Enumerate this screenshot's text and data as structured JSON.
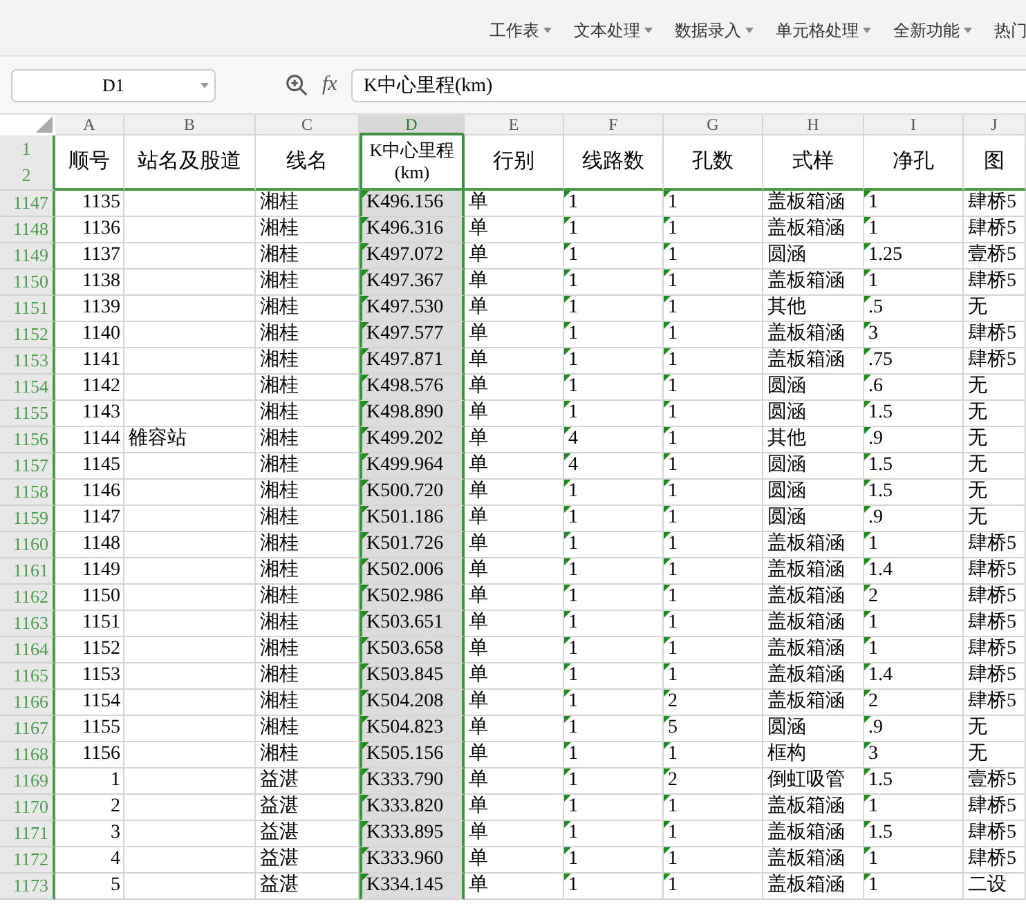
{
  "toolbar": {
    "menus": [
      {
        "label": "工作表"
      },
      {
        "label": "文本处理"
      },
      {
        "label": "数据录入"
      },
      {
        "label": "单元格处理"
      },
      {
        "label": "全新功能"
      },
      {
        "label": "热门"
      }
    ]
  },
  "formula_bar": {
    "name_box": "D1",
    "fx_label": "fx",
    "formula": "K中心里程(km)"
  },
  "columns": [
    {
      "letter": "A",
      "selected": false,
      "flagged": false
    },
    {
      "letter": "B",
      "selected": false,
      "flagged": false
    },
    {
      "letter": "C",
      "selected": false,
      "flagged": false
    },
    {
      "letter": "D",
      "selected": true,
      "flagged": true
    },
    {
      "letter": "E",
      "selected": false,
      "flagged": false
    },
    {
      "letter": "F",
      "selected": false,
      "flagged": true
    },
    {
      "letter": "G",
      "selected": false,
      "flagged": true
    },
    {
      "letter": "H",
      "selected": false,
      "flagged": false
    },
    {
      "letter": "I",
      "selected": false,
      "flagged": true
    },
    {
      "letter": "J",
      "selected": false,
      "flagged": false
    }
  ],
  "header": {
    "row_numbers": [
      "1",
      "2"
    ],
    "cells": [
      "顺号",
      "站名及股道",
      "线名",
      "K中心里程(km)",
      "行别",
      "线路数",
      "孔数",
      "式样",
      "净孔",
      "图"
    ]
  },
  "rows": [
    {
      "num": "1147",
      "cells": [
        "1135",
        "",
        "湘桂",
        "K496.156",
        "单",
        "1",
        "1",
        "盖板箱涵",
        "1",
        "肆桥5"
      ]
    },
    {
      "num": "1148",
      "cells": [
        "1136",
        "",
        "湘桂",
        "K496.316",
        "单",
        "1",
        "1",
        "盖板箱涵",
        "1",
        "肆桥5"
      ]
    },
    {
      "num": "1149",
      "cells": [
        "1137",
        "",
        "湘桂",
        "K497.072",
        "单",
        "1",
        "1",
        "圆涵",
        "1.25",
        "壹桥5"
      ]
    },
    {
      "num": "1150",
      "cells": [
        "1138",
        "",
        "湘桂",
        "K497.367",
        "单",
        "1",
        "1",
        "盖板箱涵",
        "1",
        "肆桥5"
      ]
    },
    {
      "num": "1151",
      "cells": [
        "1139",
        "",
        "湘桂",
        "K497.530",
        "单",
        "1",
        "1",
        "其他",
        ".5",
        "无"
      ]
    },
    {
      "num": "1152",
      "cells": [
        "1140",
        "",
        "湘桂",
        "K497.577",
        "单",
        "1",
        "1",
        "盖板箱涵",
        "3",
        "肆桥5"
      ]
    },
    {
      "num": "1153",
      "cells": [
        "1141",
        "",
        "湘桂",
        "K497.871",
        "单",
        "1",
        "1",
        "盖板箱涵",
        ".75",
        "肆桥5"
      ]
    },
    {
      "num": "1154",
      "cells": [
        "1142",
        "",
        "湘桂",
        "K498.576",
        "单",
        "1",
        "1",
        "圆涵",
        ".6",
        "无"
      ]
    },
    {
      "num": "1155",
      "cells": [
        "1143",
        "",
        "湘桂",
        "K498.890",
        "单",
        "1",
        "1",
        "圆涵",
        "1.5",
        "无"
      ]
    },
    {
      "num": "1156",
      "cells": [
        "1144",
        "雒容站",
        "湘桂",
        "K499.202",
        "单",
        "4",
        "1",
        "其他",
        ".9",
        "无"
      ]
    },
    {
      "num": "1157",
      "cells": [
        "1145",
        "",
        "湘桂",
        "K499.964",
        "单",
        "4",
        "1",
        "圆涵",
        "1.5",
        "无"
      ]
    },
    {
      "num": "1158",
      "cells": [
        "1146",
        "",
        "湘桂",
        "K500.720",
        "单",
        "1",
        "1",
        "圆涵",
        "1.5",
        "无"
      ]
    },
    {
      "num": "1159",
      "cells": [
        "1147",
        "",
        "湘桂",
        "K501.186",
        "单",
        "1",
        "1",
        "圆涵",
        ".9",
        "无"
      ]
    },
    {
      "num": "1160",
      "cells": [
        "1148",
        "",
        "湘桂",
        "K501.726",
        "单",
        "1",
        "1",
        "盖板箱涵",
        "1",
        "肆桥5"
      ]
    },
    {
      "num": "1161",
      "cells": [
        "1149",
        "",
        "湘桂",
        "K502.006",
        "单",
        "1",
        "1",
        "盖板箱涵",
        "1.4",
        "肆桥5"
      ]
    },
    {
      "num": "1162",
      "cells": [
        "1150",
        "",
        "湘桂",
        "K502.986",
        "单",
        "1",
        "1",
        "盖板箱涵",
        "2",
        "肆桥5"
      ]
    },
    {
      "num": "1163",
      "cells": [
        "1151",
        "",
        "湘桂",
        "K503.651",
        "单",
        "1",
        "1",
        "盖板箱涵",
        "1",
        "肆桥5"
      ]
    },
    {
      "num": "1164",
      "cells": [
        "1152",
        "",
        "湘桂",
        "K503.658",
        "单",
        "1",
        "1",
        "盖板箱涵",
        "1",
        "肆桥5"
      ]
    },
    {
      "num": "1165",
      "cells": [
        "1153",
        "",
        "湘桂",
        "K503.845",
        "单",
        "1",
        "1",
        "盖板箱涵",
        "1.4",
        "肆桥5"
      ]
    },
    {
      "num": "1166",
      "cells": [
        "1154",
        "",
        "湘桂",
        "K504.208",
        "单",
        "1",
        "2",
        "盖板箱涵",
        "2",
        "肆桥5"
      ]
    },
    {
      "num": "1167",
      "cells": [
        "1155",
        "",
        "湘桂",
        "K504.823",
        "单",
        "1",
        "5",
        "圆涵",
        ".9",
        "无"
      ]
    },
    {
      "num": "1168",
      "cells": [
        "1156",
        "",
        "湘桂",
        "K505.156",
        "单",
        "1",
        "1",
        "框构",
        "3",
        "无"
      ]
    },
    {
      "num": "1169",
      "cells": [
        "1",
        "",
        "益湛",
        "K333.790",
        "单",
        "1",
        "2",
        "倒虹吸管",
        "1.5",
        "壹桥5"
      ]
    },
    {
      "num": "1170",
      "cells": [
        "2",
        "",
        "益湛",
        "K333.820",
        "单",
        "1",
        "1",
        "盖板箱涵",
        "1",
        "肆桥5"
      ]
    },
    {
      "num": "1171",
      "cells": [
        "3",
        "",
        "益湛",
        "K333.895",
        "单",
        "1",
        "1",
        "盖板箱涵",
        "1.5",
        "肆桥5"
      ]
    },
    {
      "num": "1172",
      "cells": [
        "4",
        "",
        "益湛",
        "K333.960",
        "单",
        "1",
        "1",
        "盖板箱涵",
        "1",
        "肆桥5"
      ]
    },
    {
      "num": "1173",
      "cells": [
        "5",
        "",
        "益湛",
        "K334.145",
        "单",
        "1",
        "1",
        "盖板箱涵",
        "1",
        "二设"
      ]
    }
  ]
}
